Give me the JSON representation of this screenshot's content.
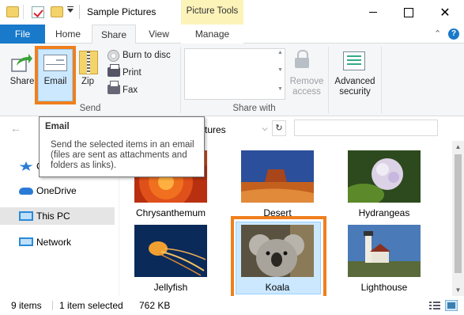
{
  "window": {
    "title": "Sample Pictures",
    "contextual_tab_group": "Picture Tools",
    "accent": "#1979ca",
    "highlight": "#f07f1d"
  },
  "tabs": [
    {
      "label": "File"
    },
    {
      "label": "Home"
    },
    {
      "label": "Share",
      "selected": true
    },
    {
      "label": "View"
    },
    {
      "label": "Manage"
    }
  ],
  "ribbon": {
    "send_group": {
      "label": "Send",
      "share": "Share",
      "email": "Email",
      "zip": "Zip",
      "burn": "Burn to disc",
      "print": "Print",
      "fax": "Fax"
    },
    "share_with_group": {
      "label": "Share with",
      "remove_access": "Remove access",
      "advanced_security": "Advanced security"
    }
  },
  "address": {
    "visible_text": "tures",
    "refresh_icon": "refresh-icon"
  },
  "tooltip": {
    "title": "Email",
    "body": "Send the selected items in an email (files are sent as attachments and folders as links)."
  },
  "nav_pane": {
    "items": [
      {
        "label": "Quick access",
        "icon": "star-icon",
        "visible_label": "C"
      },
      {
        "label": "OneDrive",
        "icon": "cloud-icon"
      },
      {
        "label": "This PC",
        "icon": "monitor-icon",
        "selected": true
      },
      {
        "label": "Network",
        "icon": "network-icon"
      }
    ]
  },
  "files": [
    {
      "name": "Chrysanthemum"
    },
    {
      "name": "Desert"
    },
    {
      "name": "Hydrangeas"
    },
    {
      "name": "Jellyfish"
    },
    {
      "name": "Koala",
      "selected": true
    },
    {
      "name": "Lighthouse"
    }
  ],
  "status": {
    "item_count": "9 items",
    "selection": "1 item selected",
    "size": "762 KB"
  }
}
